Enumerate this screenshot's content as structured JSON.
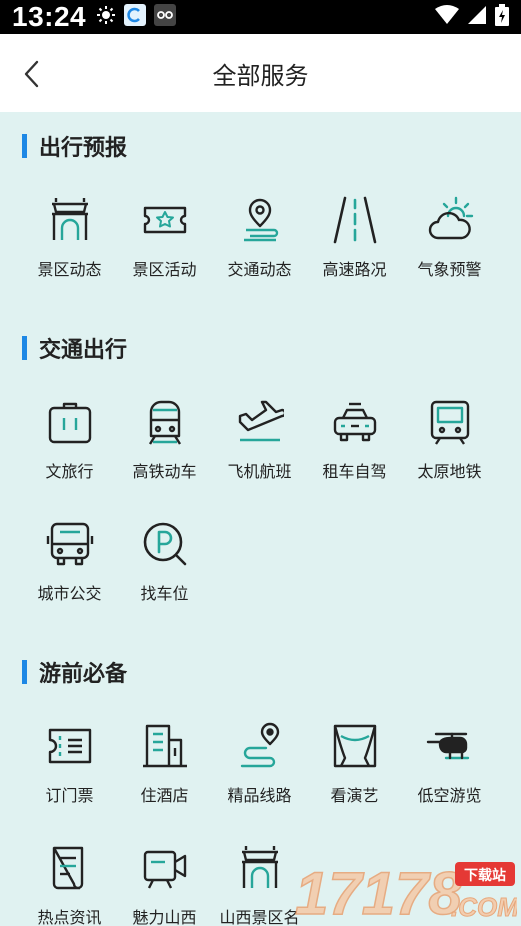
{
  "status": {
    "time": "13:24"
  },
  "header": {
    "title": "全部服务"
  },
  "sections": [
    {
      "title": "出行预报",
      "items": [
        {
          "label": "景区动态",
          "icon": "scenic-gate-icon"
        },
        {
          "label": "景区活动",
          "icon": "ticket-star-icon"
        },
        {
          "label": "交通动态",
          "icon": "location-route-icon"
        },
        {
          "label": "高速路况",
          "icon": "highway-road-icon"
        },
        {
          "label": "气象预警",
          "icon": "weather-cloud-sun-icon"
        }
      ]
    },
    {
      "title": "交通出行",
      "items": [
        {
          "label": "文旅行",
          "icon": "suitcase-icon"
        },
        {
          "label": "高铁动车",
          "icon": "train-icon"
        },
        {
          "label": "飞机航班",
          "icon": "airplane-icon"
        },
        {
          "label": "租车自驾",
          "icon": "car-icon"
        },
        {
          "label": "太原地铁",
          "icon": "subway-icon"
        },
        {
          "label": "城市公交",
          "icon": "bus-icon"
        },
        {
          "label": "找车位",
          "icon": "parking-search-icon"
        }
      ]
    },
    {
      "title": "游前必备",
      "items": [
        {
          "label": "订门票",
          "icon": "ticket-icon"
        },
        {
          "label": "住酒店",
          "icon": "hotel-icon"
        },
        {
          "label": "精品线路",
          "icon": "route-pin-icon"
        },
        {
          "label": "看演艺",
          "icon": "stage-curtain-icon"
        },
        {
          "label": "低空游览",
          "icon": "helicopter-icon"
        },
        {
          "label": "热点资讯",
          "icon": "news-doc-icon"
        },
        {
          "label": "魅力山西",
          "icon": "video-camera-icon"
        },
        {
          "label": "山西景区名",
          "icon": "scenic-gate-icon"
        }
      ]
    }
  ],
  "watermark": {
    "number": "17178",
    "domain": ".COM",
    "tag": "下载站"
  }
}
